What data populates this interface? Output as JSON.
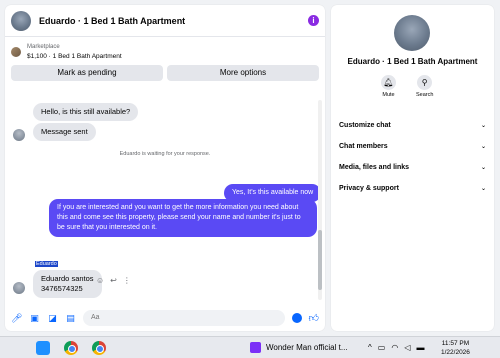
{
  "chat": {
    "title": "Eduardo · 1 Bed 1 Bath Apartment",
    "info_icon": "i",
    "listing": {
      "source": "Marketplace",
      "name": "$1,100 · 1 Bed 1 Bath Apartment"
    },
    "buttons": {
      "mark_pending": "Mark as pending",
      "more_options": "More options"
    }
  },
  "messages": {
    "incoming_1": "Hello, is this still available?",
    "incoming_2": "Message sent",
    "system_note": "Eduardo is waiting for your response.",
    "outgoing_1": "Yes, It's this available now",
    "outgoing_2": "If you are interested and you want to get the more information you need about this and come see this property, please send your name and number it's just to be sure that you interested on it.",
    "sender_label": "Eduardo",
    "incoming_3_line1": "Eduardo santos",
    "incoming_3_line2": "3476574325"
  },
  "composer": {
    "placeholder": "Aa"
  },
  "profile": {
    "name": "Eduardo · 1 Bed 1 Bath Apartment",
    "actions": [
      {
        "label": "Mute",
        "icon": "bell-icon"
      },
      {
        "label": "Search",
        "icon": "search-icon"
      }
    ],
    "menu": [
      "Customize chat",
      "Chat members",
      "Media, files and links",
      "Privacy & support"
    ]
  },
  "taskbar": {
    "media_title": "Wonder Man official t...",
    "time": "11:57 PM",
    "date": "1/22/2026"
  },
  "colors": {
    "accent": "#5a4af4",
    "messenger_blue": "#0866ff",
    "info_purple": "#8a2be2"
  }
}
